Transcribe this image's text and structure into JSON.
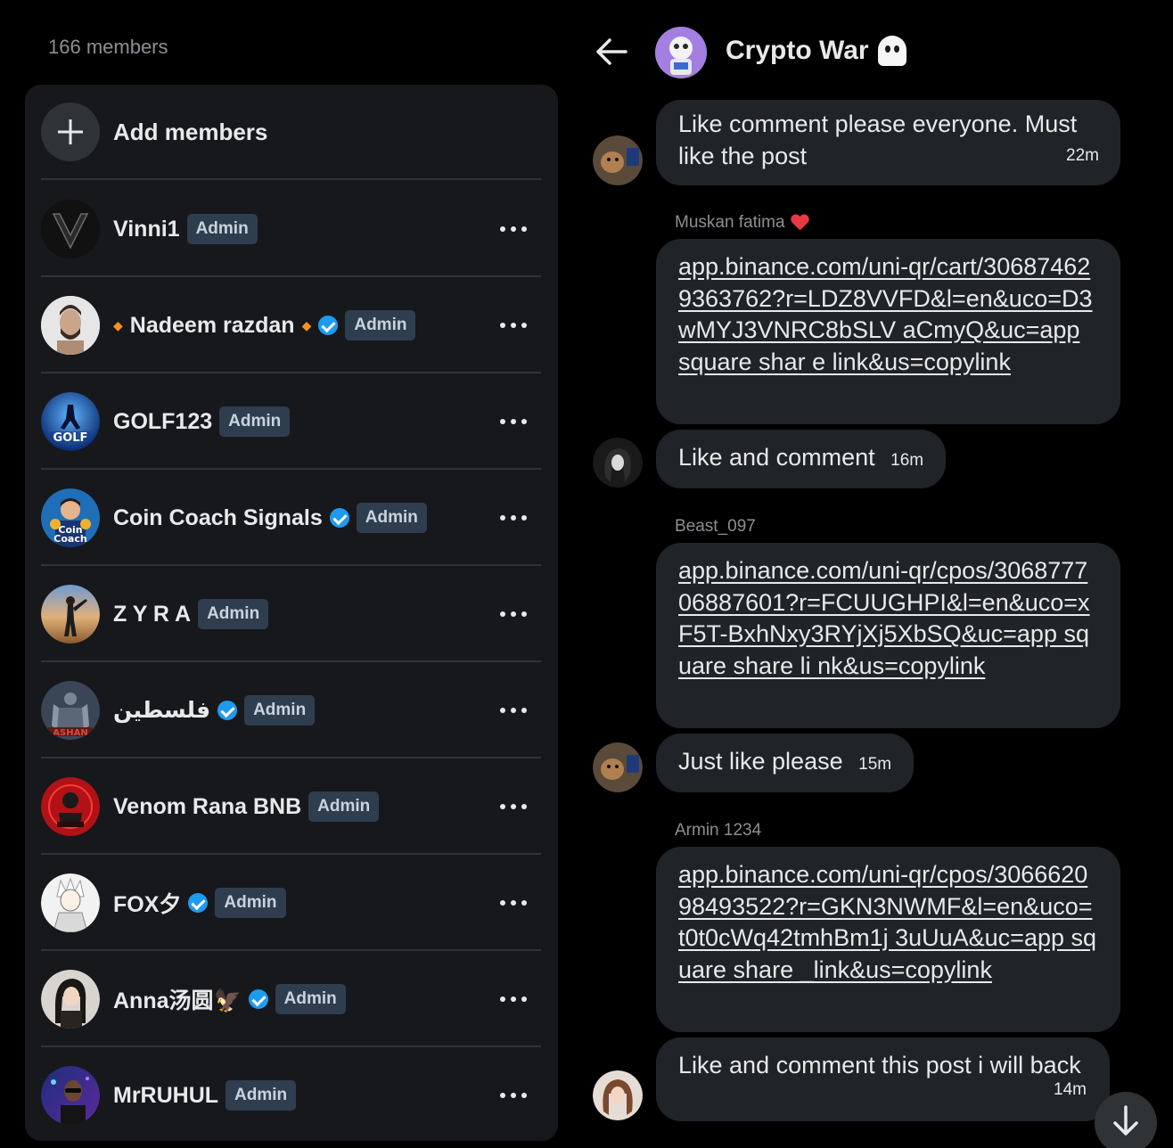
{
  "members_panel": {
    "count_label": "166 members",
    "add_label": "Add members",
    "admin_label": "Admin",
    "members": [
      {
        "name": "Vinni1",
        "verified": false,
        "avatar": "v-logo-avatar"
      },
      {
        "name": "Nadeem razdan",
        "verified": true,
        "avatar": "man-avatar",
        "decor": "◆"
      },
      {
        "name": "GOLF123",
        "verified": false,
        "avatar": "golf-avatar"
      },
      {
        "name": "Coin Coach Signals",
        "verified": true,
        "avatar": "coin-coach-avatar"
      },
      {
        "name": "Z Y R A",
        "verified": false,
        "avatar": "person-avatar"
      },
      {
        "name": "فلسطين",
        "verified": true,
        "avatar": "warrior-avatar"
      },
      {
        "name": "Venom Rana BNB",
        "verified": false,
        "avatar": "venom-avatar"
      },
      {
        "name": "FOX夕",
        "verified": true,
        "avatar": "anime-avatar"
      },
      {
        "name": "Anna汤圆🦅",
        "verified": true,
        "avatar": "woman-avatar"
      },
      {
        "name": "MrRUHUL",
        "verified": false,
        "avatar": "man-glasses-avatar"
      }
    ]
  },
  "chat": {
    "title": "Crypto War",
    "messages": [
      {
        "text": "Like comment please everyone. Must like the post",
        "time": "22m"
      },
      {
        "sender": "Muskan fatima",
        "link": "app.binance.com/uni-qr/cart/306874629363762?r=LDZ8VVFD&l=en&uco=D3wMYJ3VNRC8bSLV aCmyQ&uc=app square shar e link&us=copylink"
      },
      {
        "text": "Like and comment",
        "time": "16m"
      },
      {
        "sender": "Beast_097",
        "link": "app.binance.com/uni-qr/cpos/306877706887601?r=FCUUGHPI&l=en&uco=xF5T-BxhNxy3RYjXj5XbSQ&uc=app square share li nk&us=copylink"
      },
      {
        "text": "Just like please",
        "time": "15m"
      },
      {
        "sender": "Armin 1234",
        "link": "app.binance.com/uni-qr/cpos/306662098493522?r=GKN3NWMF&l=en&uco=t0t0cWq42tmhBm1j 3uUuA&uc=app square share _link&us=copylink"
      },
      {
        "text": "Like and comment this post i will back",
        "time": "14m"
      }
    ]
  },
  "colors": {
    "background": "#000000",
    "card": "#16181c",
    "bubble": "#202327",
    "verified": "#1d9bf0",
    "admin_badge": "#2f3e4e",
    "muted_text": "#8b8f94"
  }
}
